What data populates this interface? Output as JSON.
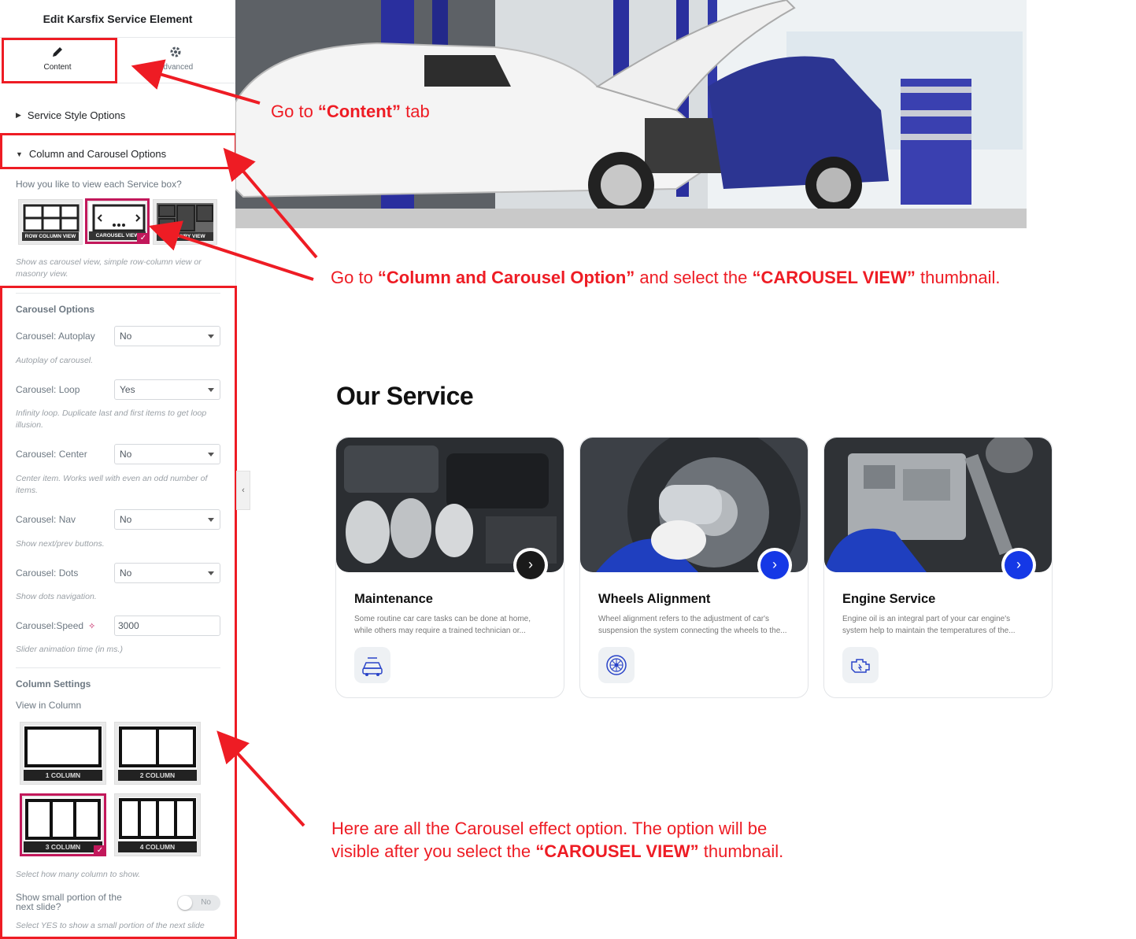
{
  "sidebar": {
    "title": "Edit Karsfix Service Element",
    "tabs": {
      "content": "Content",
      "advanced": "Advanced"
    },
    "sections": {
      "service_style": "Service Style Options",
      "column_carousel": "Column and Carousel Options"
    },
    "view_question": "How you like to view each Service box?",
    "view_options": [
      "ROW COLUMN VIEW",
      "CAROUSEL VIEW",
      "MASONRY VIEW"
    ],
    "view_selected": "CAROUSEL VIEW",
    "view_help": "Show as carousel view, simple row-column view or masonry view.",
    "carousel": {
      "title": "Carousel Options",
      "autoplay": {
        "label": "Carousel: Autoplay",
        "value": "No",
        "help": "Autoplay of carousel."
      },
      "loop": {
        "label": "Carousel: Loop",
        "value": "Yes",
        "help": "Infinity loop. Duplicate last and first items to get loop illusion."
      },
      "center": {
        "label": "Carousel: Center",
        "value": "No",
        "help": "Center item. Works well with even an odd number of items."
      },
      "nav": {
        "label": "Carousel: Nav",
        "value": "No",
        "help": "Show next/prev buttons."
      },
      "dots": {
        "label": "Carousel: Dots",
        "value": "No",
        "help": "Show dots navigation."
      },
      "speed": {
        "label": "Carousel:Speed",
        "value": "3000",
        "help": "Slider animation time (in ms.)"
      }
    },
    "columns": {
      "title": "Column Settings",
      "view_label": "View in Column",
      "options": [
        "1 COLUMN",
        "2 COLUMN",
        "3 COLUMN",
        "4 COLUMN"
      ],
      "selected": "3 COLUMN",
      "help": "Select how many column to show.",
      "small_portion_label": "Show small portion of the next slide?",
      "small_portion_value": "No",
      "small_portion_help": "Select YES to show a small portion of the next slide"
    }
  },
  "annotations": {
    "a1_pre": "Go  to ",
    "a1_bold": "“Content”",
    "a1_post": " tab",
    "a2_pre": "Go to ",
    "a2_bold1": "“Column and Carousel Option”",
    "a2_mid": " and select the ",
    "a2_bold2": "“CAROUSEL VIEW”",
    "a2_post": " thumbnail.",
    "a3_line1": "Here are all the Carousel effect option. The option will be",
    "a3_pre": "visible after you select the ",
    "a3_bold": "“CAROUSEL VIEW”",
    "a3_post": " thumbnail."
  },
  "service": {
    "title": "Our Service",
    "cards": [
      {
        "title": "Maintenance",
        "text": "Some routine car care tasks can be done at home, while others may require a trained technician or...",
        "icon": "car-service-icon",
        "arrow_color": "#1a1a1a"
      },
      {
        "title": "Wheels Alignment",
        "text": "Wheel alignment refers to the adjustment of car's suspension the system connecting the wheels to the...",
        "icon": "wheel-icon",
        "arrow_color": "#1538e6"
      },
      {
        "title": "Engine Service",
        "text": "Engine oil is an integral part of your car engine's system help to maintain the temperatures of the...",
        "icon": "engine-icon",
        "arrow_color": "#1538e6"
      }
    ]
  },
  "colors": {
    "annotation": "#ee1c24",
    "selected": "#c2185b",
    "accent": "#1538e6"
  }
}
